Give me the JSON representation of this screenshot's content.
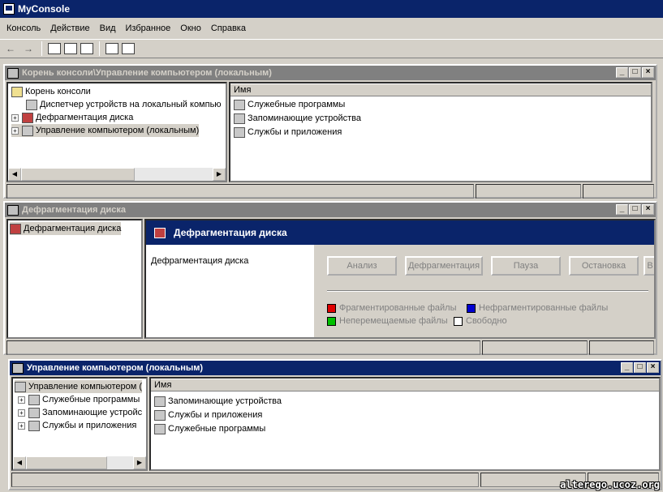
{
  "app": {
    "title": "MyConsole"
  },
  "menu": [
    "Консоль",
    "Действие",
    "Вид",
    "Избранное",
    "Окно",
    "Справка"
  ],
  "win1": {
    "title": "Корень консоли\\Управление компьютером (локальным)",
    "tree": [
      "Корень консоли",
      "Диспетчер устройств на локальный компью",
      "Дефрагментация диска",
      "Управление компьютером (локальным)"
    ],
    "column": "Имя",
    "list": [
      "Служебные программы",
      "Запоминающие устройства",
      "Службы и приложения"
    ]
  },
  "win2": {
    "title": "Дефрагментация диска",
    "tree": [
      "Дефрагментация диска"
    ],
    "banner": "Дефрагментация диска",
    "left_label": "Дефрагментация диска",
    "buttons": [
      "Анализ",
      "Дефрагментация",
      "Пауза",
      "Остановка",
      "В"
    ],
    "legend": [
      {
        "label": "Фрагментированные файлы",
        "color": "#e00000"
      },
      {
        "label": "Нефрагментированные файлы",
        "color": "#0000d0"
      },
      {
        "label": "Неперемещаемые файлы",
        "color": "#00c000"
      },
      {
        "label": "Свободно",
        "color": "#ffffff"
      }
    ]
  },
  "win3": {
    "title": "Управление компьютером (локальным)",
    "tree": [
      "Управление компьютером (",
      "Служебные программы",
      "Запоминающие устройс",
      "Службы и приложения"
    ],
    "column": "Имя",
    "list": [
      "Запоминающие устройства",
      "Службы и приложения",
      "Служебные программы"
    ]
  },
  "watermark": "alterego.ucoz.org"
}
